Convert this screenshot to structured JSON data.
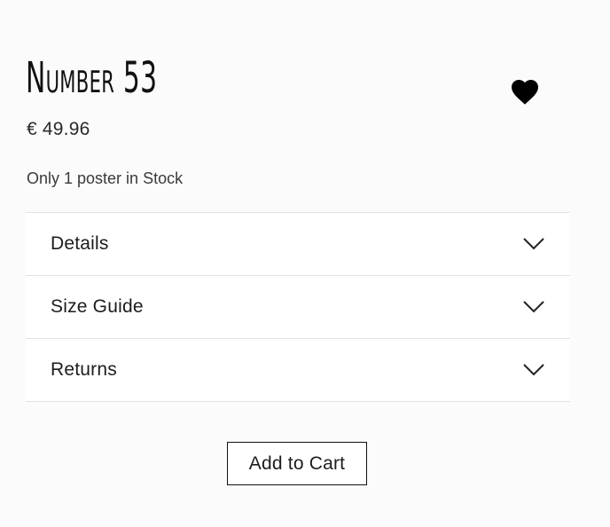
{
  "product": {
    "title": "Number 53",
    "price": "€ 49.96",
    "stock_text": "Only 1 poster in Stock",
    "favorite_icon": "heart-icon"
  },
  "accordion": {
    "items": [
      {
        "label": "Details",
        "icon": "chevron-down-icon"
      },
      {
        "label": "Size Guide",
        "icon": "chevron-down-icon"
      },
      {
        "label": "Returns",
        "icon": "chevron-down-icon"
      }
    ]
  },
  "actions": {
    "add_to_cart_label": "Add to Cart"
  },
  "colors": {
    "background": "#fcfbfb",
    "text": "#1c1c1c",
    "divider": "#e2e2e2",
    "heart": "#000000"
  }
}
